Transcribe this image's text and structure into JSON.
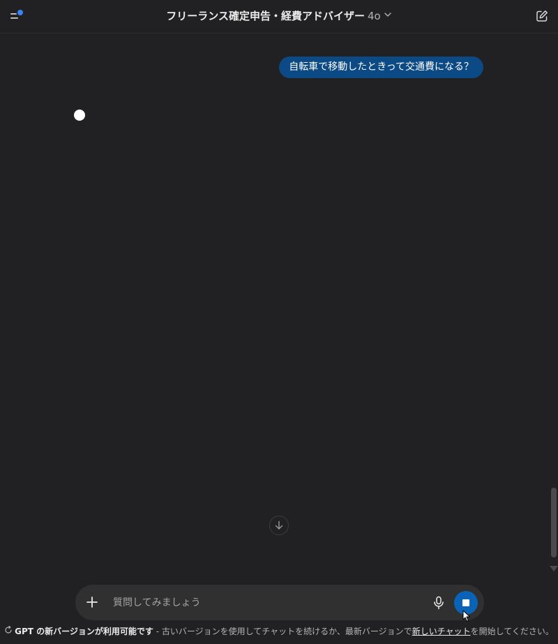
{
  "header": {
    "title": "フリーランス確定申告・経費アドバイザー",
    "model": "4o",
    "icons": {
      "sidebar": "sidebar-toggle-icon",
      "chevron": "chevron-down-icon",
      "new_chat": "new-chat-icon"
    }
  },
  "conversation": {
    "user_message": "自転車で移動したときって交通費になる？",
    "assistant_state": "typing"
  },
  "composer": {
    "placeholder": "質問してみましょう",
    "value": "",
    "icons": {
      "attach": "plus-icon",
      "voice": "microphone-icon",
      "stop": "stop-icon"
    }
  },
  "notice": {
    "bold": "GPT の新バージョンが利用可能です",
    "text_before": " - 古いバージョンを使用してチャットを続けるか、最新バージョンで",
    "link": "新しいチャット",
    "text_after": "を開始してください。"
  },
  "colors": {
    "background": "#212123",
    "user_bubble": "#0b4a85",
    "accent": "#0a63b6",
    "notification_dot": "#3b82f6"
  }
}
